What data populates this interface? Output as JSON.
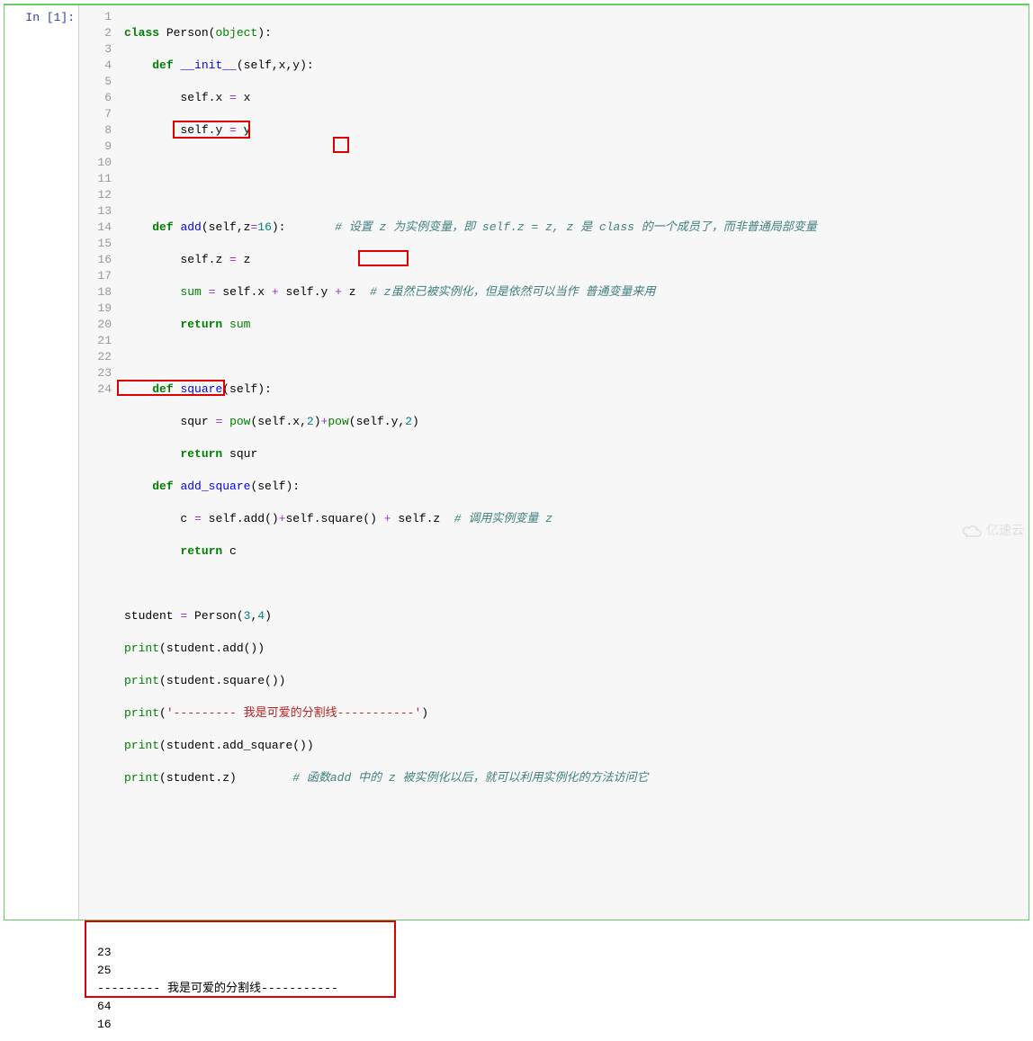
{
  "prompt": "In [1]:",
  "line_numbers": [
    "1",
    "2",
    "3",
    "4",
    "5",
    "6",
    "7",
    "8",
    "9",
    "10",
    "11",
    "12",
    "13",
    "14",
    "15",
    "16",
    "17",
    "18",
    "19",
    "20",
    "21",
    "22",
    "23",
    "24"
  ],
  "code": {
    "l1": {
      "kw1": "class",
      "cls": "Person",
      "paren": "(",
      "builtin": "object",
      "close": "):"
    },
    "l2": {
      "kw1": "def",
      "fn": "__init__",
      "args": "(self,x,y):"
    },
    "l3": {
      "self": "self",
      "dot": ".x ",
      "op": "=",
      "rest": " x"
    },
    "l4": {
      "self": "self",
      "dot": ".y ",
      "op": "=",
      "rest": " y"
    },
    "l7": {
      "kw1": "def",
      "fn": "add",
      "args": "(self,z",
      "op": "=",
      "num": "16",
      "close": "):",
      "comment": "# 设置 z 为实例变量，即 self.z = z, z 是 class 的一个成员了，而非普通局部变量"
    },
    "l8": {
      "self": "self",
      "rest": ".z ",
      "op": "=",
      "rest2": " z"
    },
    "l9": {
      "builtin": "sum",
      "sp": " ",
      "op": "=",
      "sp2": " ",
      "self1": "self",
      "p1": ".x ",
      "op2": "+",
      "sp3": " ",
      "self2": "self",
      "p2": ".y ",
      "op3": "+",
      "sp4": " ",
      "z": "z",
      "comment": "  # z虽然已被实例化，但是依然可以当作 普通变量来用"
    },
    "l10": {
      "kw1": "return",
      "sp": " ",
      "builtin": "sum"
    },
    "l12": {
      "kw1": "def",
      "fn": "square",
      "args": "(self):"
    },
    "l13": {
      "v": "squr ",
      "op": "=",
      "sp": " ",
      "pow1": "pow",
      "p1": "(",
      "self1": "self",
      "px": ".x,",
      "n2": "2",
      "pc": ")",
      "op2": "+",
      "pow2": "pow",
      "p2": "(",
      "self2": "self",
      "py": ".y,",
      "n3": "2",
      "pc2": ")"
    },
    "l14": {
      "kw1": "return",
      "rest": " squr"
    },
    "l15": {
      "kw1": "def",
      "fn": "add_square",
      "args": "(self):"
    },
    "l16": {
      "v": "c ",
      "op": "=",
      "sp": " ",
      "self1": "self",
      "m1": ".add()",
      "op2": "+",
      "self2": "self",
      "m2": ".square() ",
      "op3": "+",
      "sp2": " ",
      "self3": "self",
      "pz": ".z",
      "comment": "  # 调用实例变量 z"
    },
    "l17": {
      "kw1": "return",
      "rest": " c"
    },
    "l19": {
      "v": "student ",
      "op": "=",
      "sp": " ",
      "cls": "Person",
      "p": "(",
      "n1": "3",
      "c": ",",
      "n2": "4",
      "pc": ")"
    },
    "l20": {
      "pr": "print",
      "p": "(student.add())"
    },
    "l21": {
      "pr": "print",
      "p": "(student.square())"
    },
    "l22": {
      "pr": "print",
      "p": "(",
      "str": "'--------- 我是可爱的分割线-----------'",
      "pc": ")"
    },
    "l23": {
      "pr": "print",
      "p": "(student.add_square())"
    },
    "l24": {
      "pr": "print",
      "p": "(student.z)",
      "comment": "# 函数add 中的 z 被实例化以后，就可以利用实例化的方法访问它"
    }
  },
  "output": {
    "line1": "23",
    "line2": "25",
    "line3": "--------- 我是可爱的分割线-----------",
    "line4": "64",
    "line5": "16"
  },
  "watermark": "亿速云"
}
